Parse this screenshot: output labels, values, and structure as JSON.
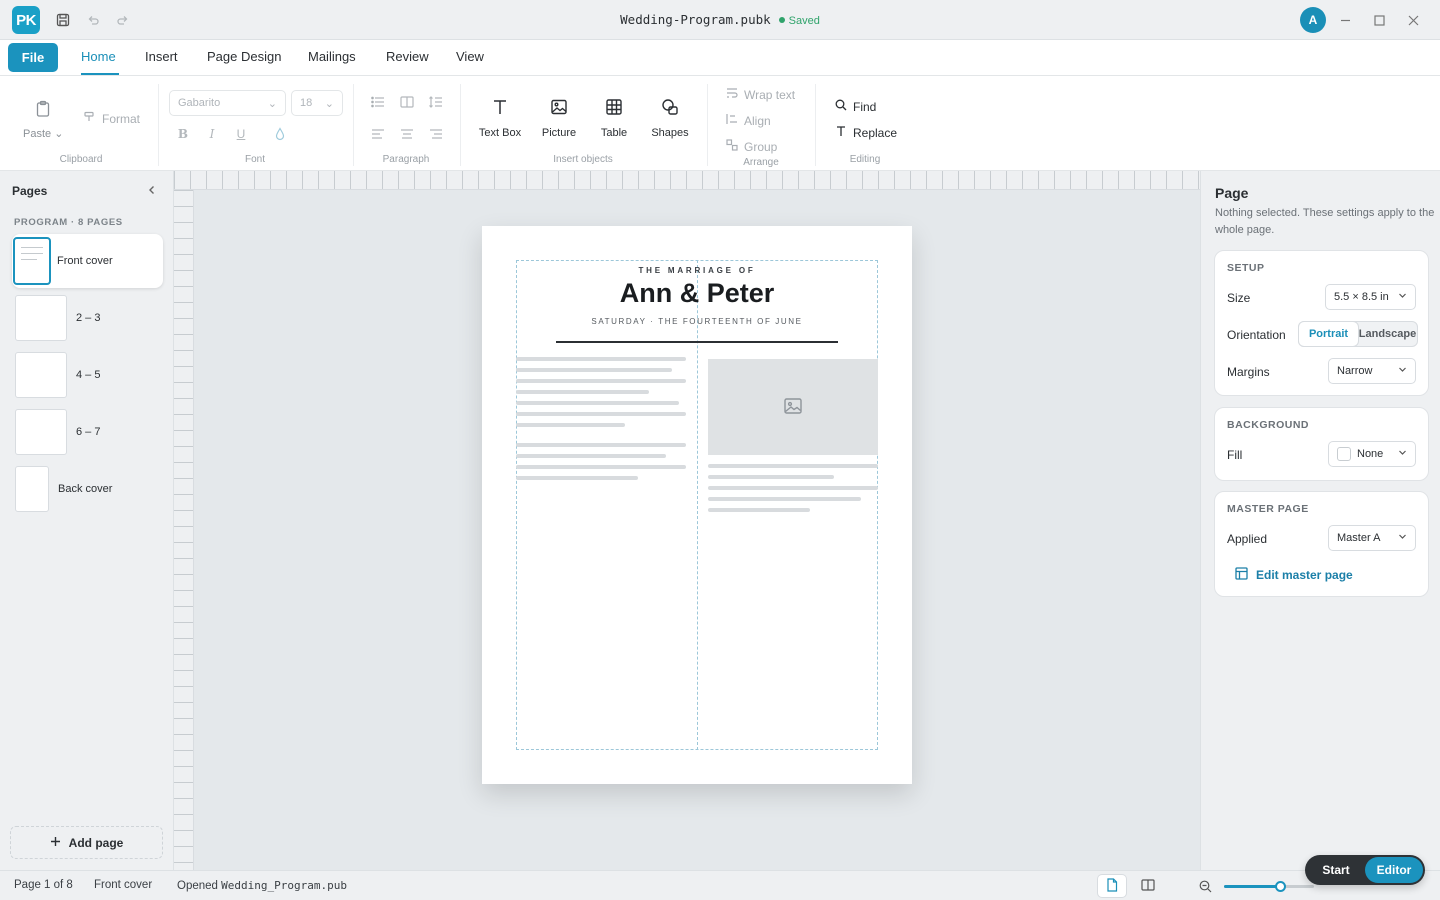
{
  "app": {
    "logo": "PK",
    "doc_name": "Wedding-Program.pubk",
    "save_status": "Saved",
    "user_initial": "A"
  },
  "tabs": {
    "file": "File",
    "home": "Home",
    "insert": "Insert",
    "page_design": "Page Design",
    "mailings": "Mailings",
    "review": "Review",
    "view": "View"
  },
  "ribbon": {
    "clipboard": {
      "paste": "Paste",
      "format": "Format",
      "label": "Clipboard"
    },
    "font": {
      "family": "Gabarito",
      "size": "18",
      "label": "Font"
    },
    "paragraph": {
      "label": "Paragraph"
    },
    "insert_objects": {
      "text_box": "Text Box",
      "picture": "Picture",
      "table": "Table",
      "shapes": "Shapes",
      "label": "Insert objects"
    },
    "arrange": {
      "wrap_text": "Wrap text",
      "align": "Align",
      "group": "Group",
      "label": "Arrange"
    },
    "editing": {
      "find": "Find",
      "replace": "Replace",
      "label": "Editing"
    }
  },
  "pages_panel": {
    "title": "Pages",
    "section": "PROGRAM · 8 PAGES",
    "items": [
      {
        "label": "Front cover"
      },
      {
        "label": "2 – 3"
      },
      {
        "label": "4 – 5"
      },
      {
        "label": "6 – 7"
      },
      {
        "label": "Back cover"
      }
    ],
    "add_page": "Add page"
  },
  "document": {
    "kicker": "THE MARRIAGE OF",
    "names": "Ann & Peter",
    "date_line": "SATURDAY · THE FOURTEENTH OF JUNE"
  },
  "page_panel": {
    "title": "Page",
    "description": "Nothing selected. These settings apply to the whole page.",
    "setup": {
      "heading": "SETUP",
      "size_label": "Size",
      "size_value": "5.5 × 8.5 in",
      "orientation_label": "Orientation",
      "portrait": "Portrait",
      "landscape": "Landscape",
      "margins_label": "Margins",
      "margins_value": "Narrow"
    },
    "background": {
      "heading": "BACKGROUND",
      "fill_label": "Fill",
      "fill_value": "None"
    },
    "master_page": {
      "heading": "MASTER PAGE",
      "applied_label": "Applied",
      "applied_value": "Master A",
      "edit_link": "Edit master page"
    }
  },
  "status_bar": {
    "page_info": "Page 1 of 8",
    "current_page": "Front cover",
    "opened_prefix": "Opened",
    "opened_file": "Wedding_Program.pub",
    "zoom_level": 0.62
  },
  "mode_toggle": {
    "start": "Start",
    "editor": "Editor"
  },
  "colors": {
    "accent": "#1b93be",
    "saved": "#2fa36b"
  }
}
